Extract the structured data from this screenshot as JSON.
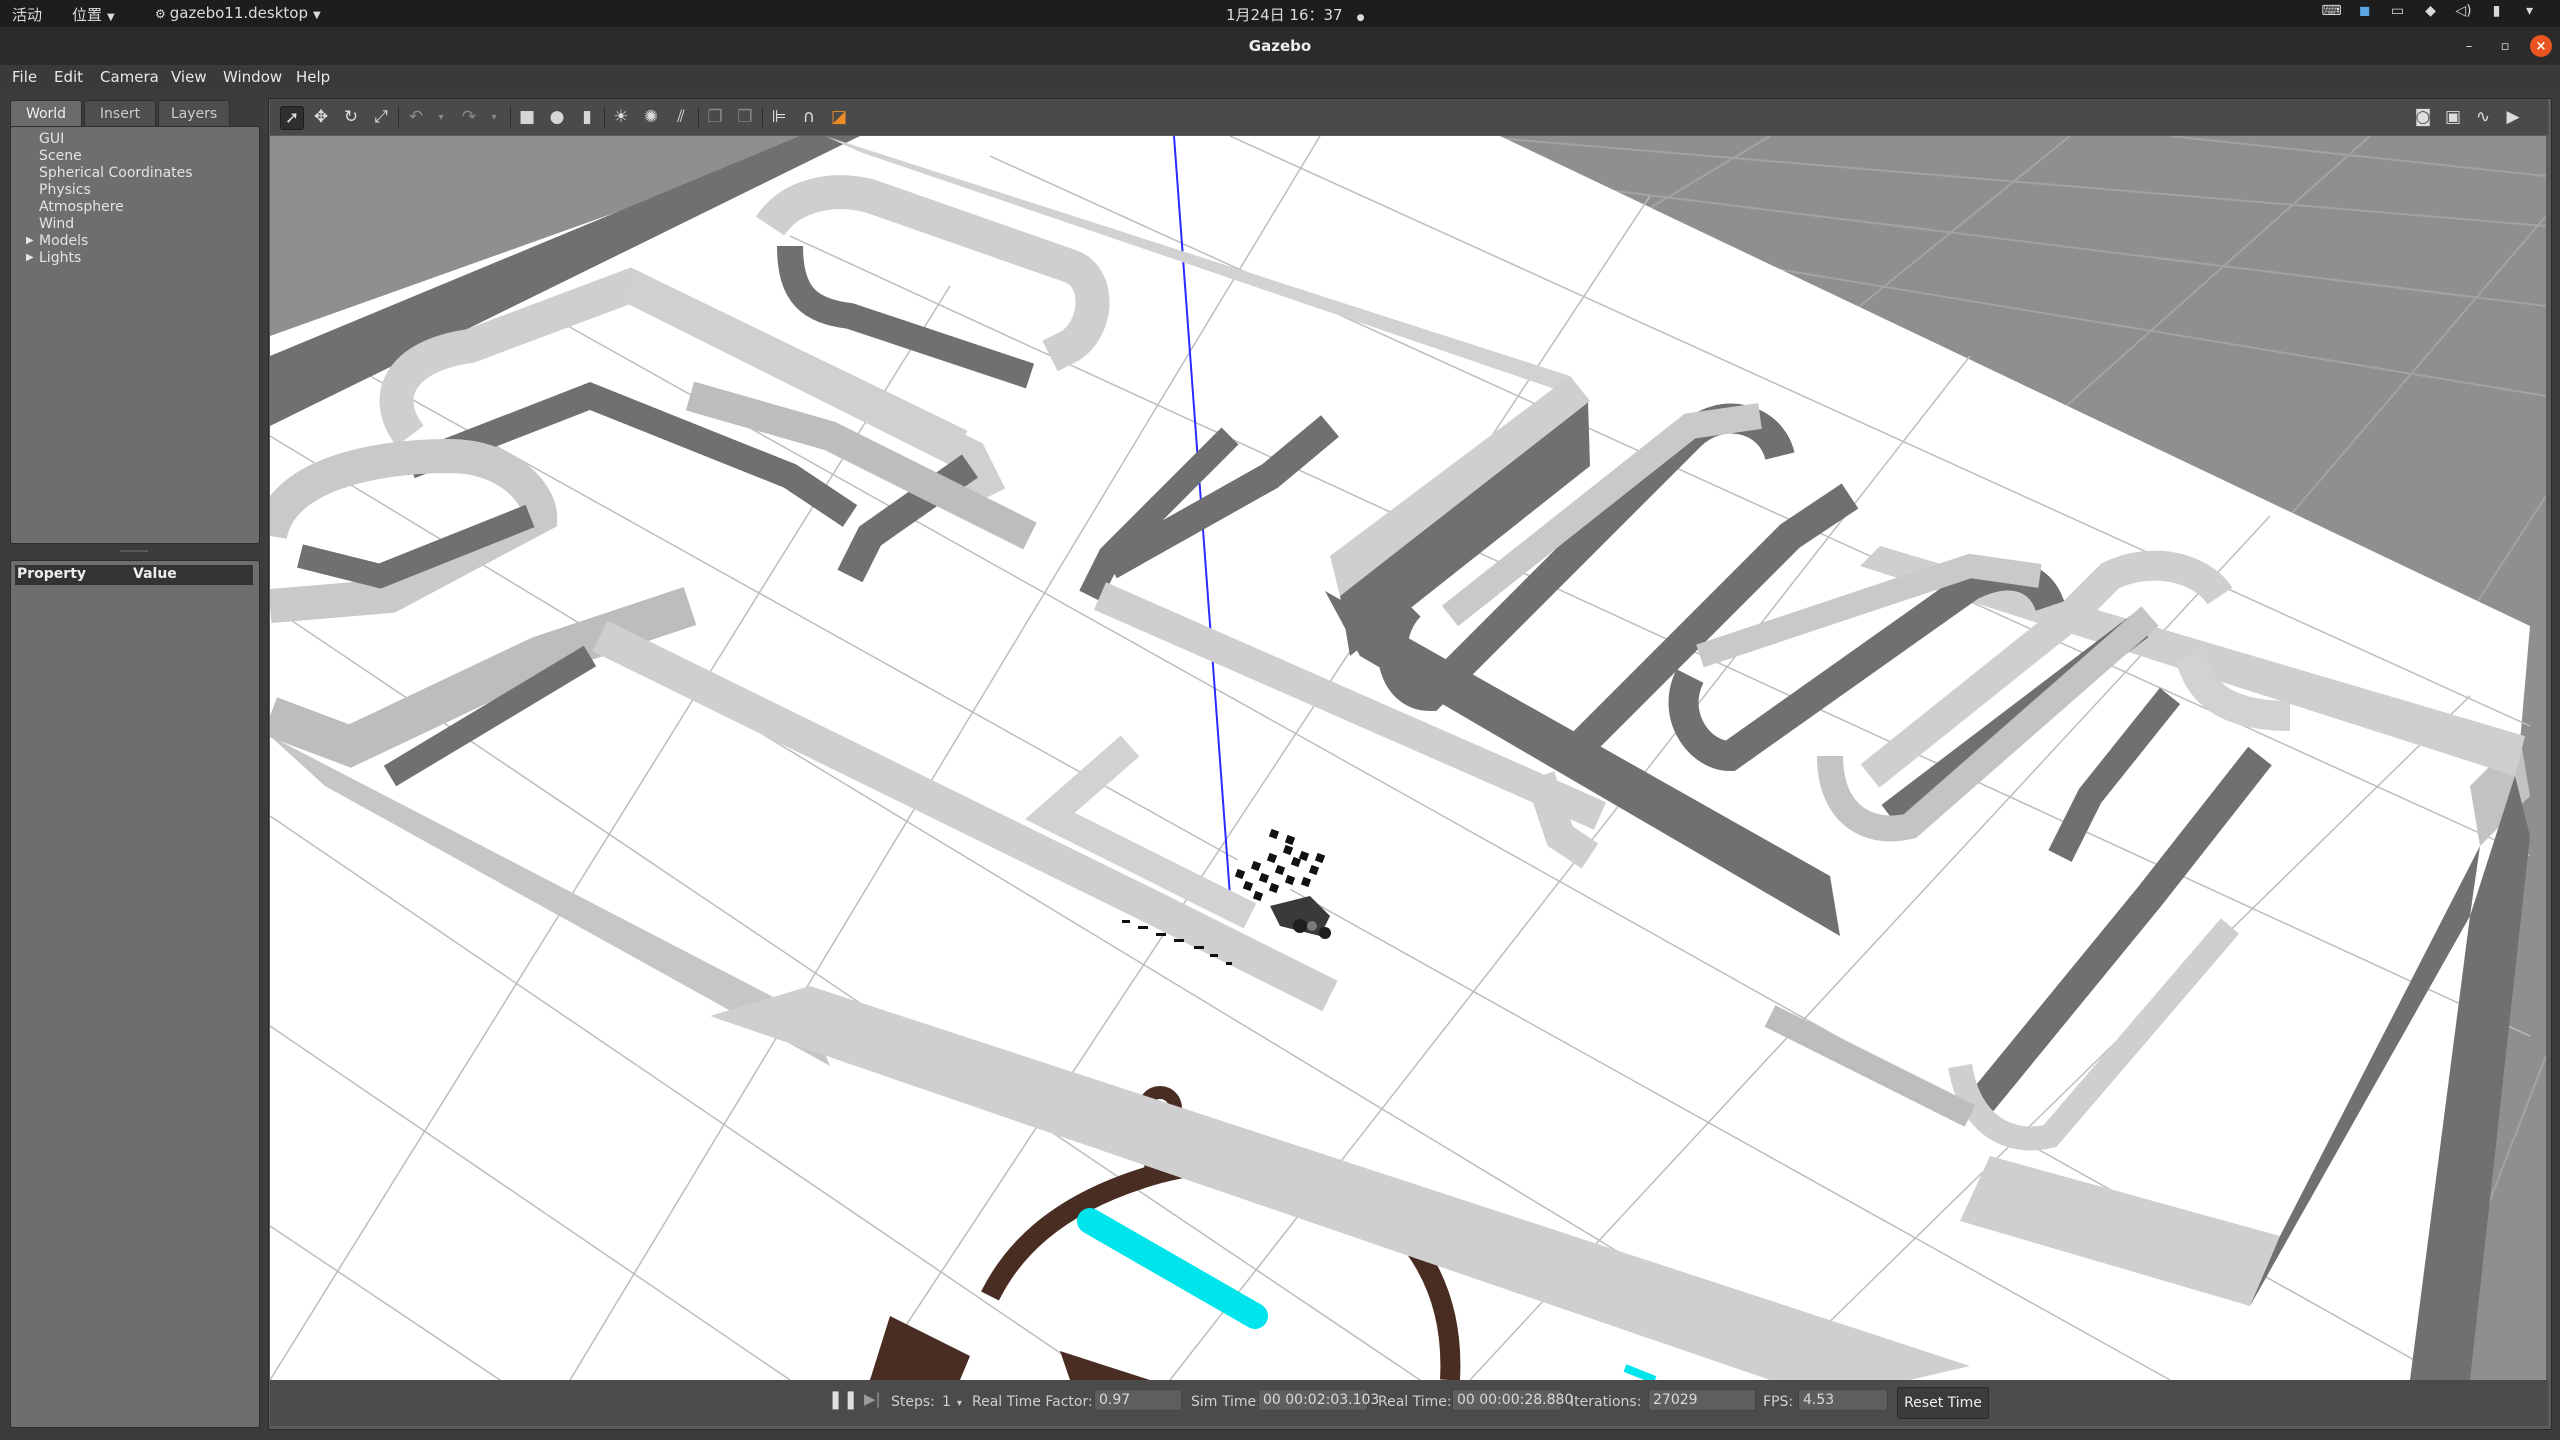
{
  "topbar": {
    "activities": "活动",
    "places": "位置",
    "app_name": "gazebo11.desktop",
    "clock": "1月24日 16：37"
  },
  "window": {
    "title": "Gazebo"
  },
  "menu": [
    "File",
    "Edit",
    "Camera",
    "View",
    "Window",
    "Help"
  ],
  "left_panel": {
    "tabs": [
      "World",
      "Insert",
      "Layers"
    ],
    "active_tab": "World",
    "tree": [
      "GUI",
      "Scene",
      "Spherical Coordinates",
      "Physics",
      "Atmosphere",
      "Wind",
      "Models",
      "Lights"
    ],
    "expandable": [
      "Models",
      "Lights"
    ],
    "property_header": {
      "property": "Property",
      "value": "Value"
    }
  },
  "toolbar": {
    "active_tool": "select-mode",
    "tools": [
      "select-mode",
      "translate-mode",
      "rotate-mode",
      "scale-mode",
      "undo",
      "redo",
      "box",
      "sphere",
      "cylinder",
      "point-light",
      "spot-light",
      "directional-light",
      "copy",
      "paste",
      "align",
      "snap",
      "change-view"
    ],
    "right_tools": [
      "screenshot",
      "log",
      "plot",
      "record-video"
    ]
  },
  "status": {
    "steps_label": "Steps:",
    "steps_value": "1",
    "rtf_label": "Real Time Factor:",
    "rtf_value": "0.97",
    "sim_time_label": "Sim Time:",
    "sim_time_value": "00 00:02:03.103",
    "real_time_label": "Real Time:",
    "real_time_value": "00 00:00:28.880",
    "iterations_label": "Iterations:",
    "iterations_value": "27029",
    "fps_label": "FPS:",
    "fps_value": "4.53",
    "reset_label": "Reset Time"
  },
  "scene": {
    "ground_color": "#8f8f8f",
    "floor_color": "#ffffff",
    "wall_top_color": "#cfcfcf",
    "wall_side_color": "#707070",
    "logo_color": "#4a2d22",
    "logo_accent_color": "#00e5ec",
    "z_axis_color": "#2b2bff"
  }
}
